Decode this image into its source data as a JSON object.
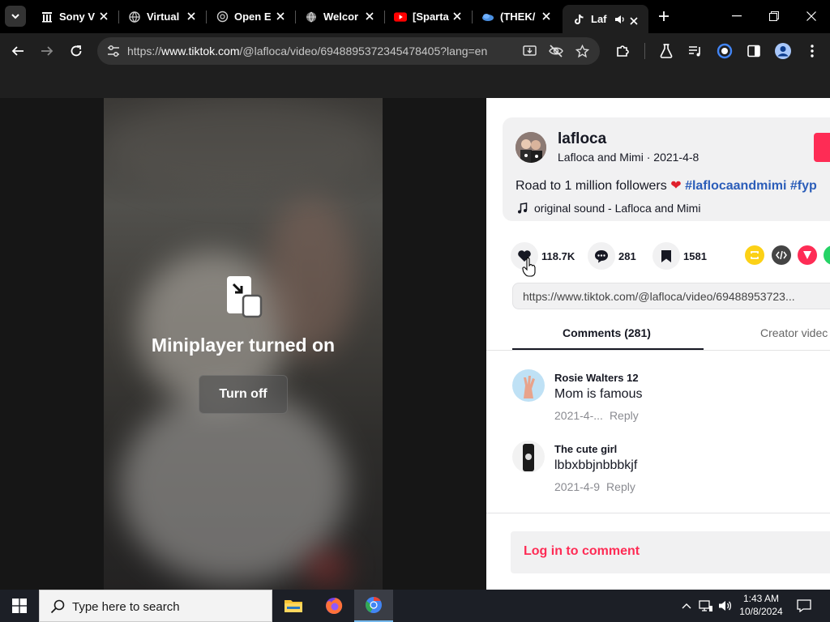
{
  "browser": {
    "tabs": [
      {
        "title": "Sony V",
        "icon": "tiktok-like-columns-icon"
      },
      {
        "title": "Virtual",
        "icon": "globe-icon"
      },
      {
        "title": "Open E",
        "icon": "openai-icon"
      },
      {
        "title": "Welcor",
        "icon": "globe-icon"
      },
      {
        "title": "[Sparta",
        "icon": "youtube-icon"
      },
      {
        "title": "(THEK/",
        "icon": "cloud-icon"
      },
      {
        "title": "Laf",
        "icon": "tiktok-icon",
        "active": true,
        "audio": true
      }
    ],
    "url": {
      "prefix": "https://",
      "host": "www.tiktok.com",
      "path": "/@lafloca/video/6948895372345478405?lang=en"
    }
  },
  "video": {
    "miniplayer_text": "Miniplayer turned on",
    "turn_off_label": "Turn off"
  },
  "post": {
    "username": "lafloca",
    "display_name": "Lafloca and Mimi",
    "separator": " · ",
    "date": "2021-4-8",
    "caption_text": "Road to 1 million followers ",
    "heart_emoji": "❤️",
    "hashtags": [
      "#laflocaandmimi",
      "#fyp"
    ],
    "sound": "original sound - Lafloca and Mimi",
    "stats": {
      "likes": "118.7K",
      "comments": "281",
      "saves": "1581"
    },
    "copy_link": "https://www.tiktok.com/@lafloca/video/69488953723..."
  },
  "comments_tabs": {
    "comments": "Comments (281)",
    "creator": "Creator videc"
  },
  "comments": [
    {
      "name": "Rosie Walters 12",
      "text": "Mom is famous",
      "date": "2021-4-...",
      "reply": "Reply"
    },
    {
      "name": "The cute girl",
      "text": "lbbxbbjnbbbkjf",
      "date": "2021-4-9",
      "reply": "Reply"
    }
  ],
  "login": {
    "label": "Log in to comment"
  },
  "taskbar": {
    "search_placeholder": "Type here to search",
    "time": "1:43 AM",
    "date": "10/8/2024"
  },
  "colors": {
    "tiktok_red": "#fe2c55",
    "hashtag_blue": "#2b5db9",
    "chrome_dark": "#1f1f1f"
  }
}
